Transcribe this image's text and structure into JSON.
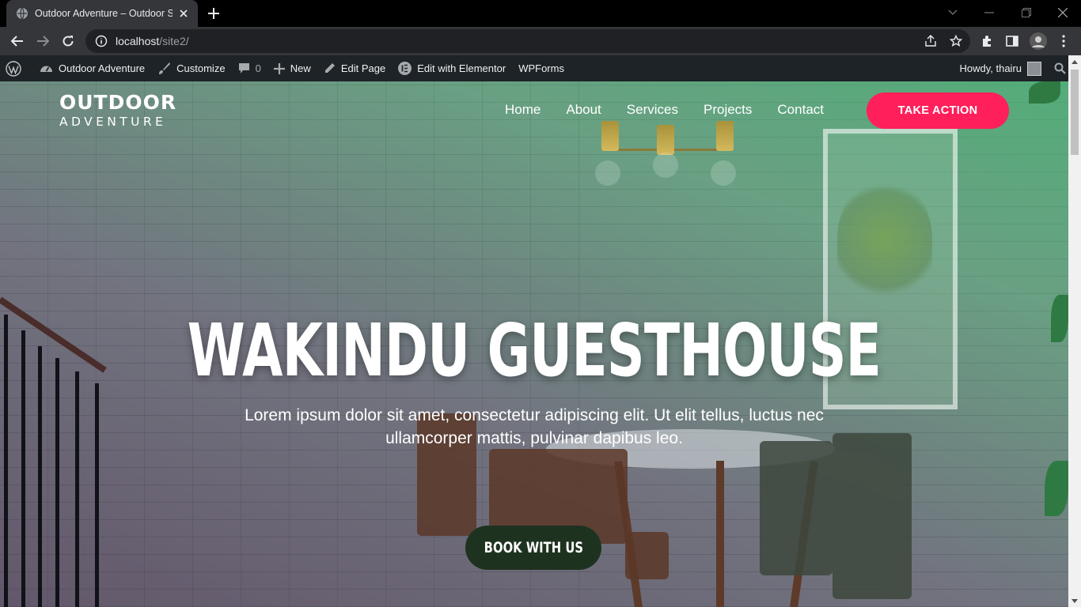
{
  "browser": {
    "tab_title": "Outdoor Adventure – Outdoor Sp",
    "url_host": "localhost",
    "url_path": "/site2/"
  },
  "adminbar": {
    "site_name": "Outdoor Adventure",
    "customize": "Customize",
    "comments_count": "0",
    "new": "New",
    "edit_page": "Edit Page",
    "edit_elementor": "Edit with Elementor",
    "wpforms": "WPForms",
    "howdy": "Howdy, thairu"
  },
  "site": {
    "logo_line1": "OUTDOOR",
    "logo_line2": "ADVENTURE",
    "nav": [
      "Home",
      "About",
      "Services",
      "Projects",
      "Contact"
    ],
    "cta": "TAKE ACTION"
  },
  "hero": {
    "title": "WAKINDU GUESTHOUSE",
    "subtitle": "Lorem ipsum dolor sit amet, consectetur adipiscing elit. Ut elit tellus, luctus nec ullamcorper mattis, pulvinar dapibus leo.",
    "button": "BOOK WITH US"
  },
  "colors": {
    "cta": "#ff1f5a",
    "book_button": "#1e3220",
    "adminbar": "#1d2327",
    "chrome_dark": "#35363a"
  }
}
